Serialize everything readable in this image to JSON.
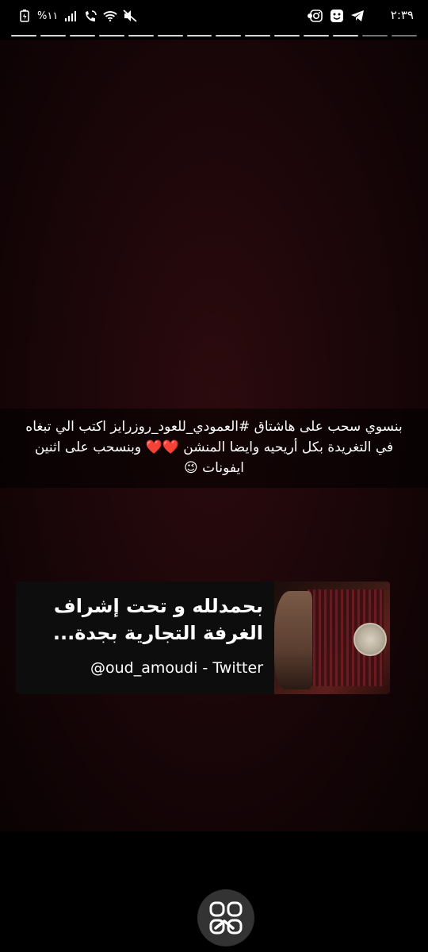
{
  "status_bar": {
    "time": "٢:٣٩",
    "battery": "%١١",
    "right_icons": [
      "telegram-icon",
      "sticker-app-icon",
      "instagram-icon"
    ],
    "left_icons": [
      "battery-icon",
      "signal-icon",
      "wifi-call-icon",
      "wifi-icon",
      "mute-icon"
    ]
  },
  "story": {
    "progress_total": 14,
    "progress_seen": 12,
    "caption_lines": [
      "بنسوي سحب على هاشتاق #العمودي_للعود_روزرايز اكتب الي تبغاه",
      "في التغريدة بكل أريحيه وايضا المنشن ❤️❤️ وبنسحب على اثنين",
      "ايفونات 😉"
    ],
    "link_card": {
      "title": "بحمدلله و تحت إشراف الغرفة التجارية بجدة...",
      "source": "@oud_amoudi - Twitter"
    }
  },
  "colors": {
    "background": "#000000",
    "story_bg": "#1e070a",
    "text": "#ffffff"
  }
}
